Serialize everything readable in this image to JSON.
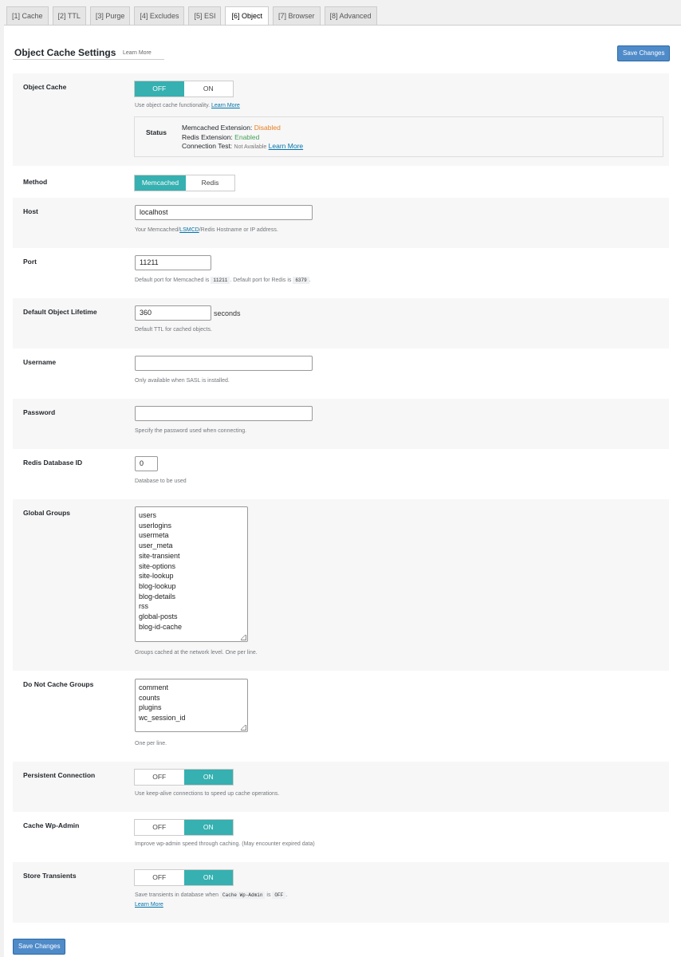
{
  "tabs": [
    "[1] Cache",
    "[2] TTL",
    "[3] Purge",
    "[4] Excludes",
    "[5] ESI",
    "[6] Object",
    "[7] Browser",
    "[8] Advanced"
  ],
  "active_tab": "[6] Object",
  "header": {
    "title": "Object Cache Settings",
    "learn_more": "Learn More",
    "save_label": "Save Changes"
  },
  "toggle_labels": {
    "off": "OFF",
    "on": "ON"
  },
  "object_cache": {
    "label": "Object Cache",
    "value": "OFF",
    "desc": "Use object cache functionality.",
    "desc_link": "Learn More",
    "status": {
      "label": "Status",
      "memcached_label": "Memcached Extension:",
      "memcached_value": "Disabled",
      "redis_label": "Redis Extension:",
      "redis_value": "Enabled",
      "conn_label": "Connection Test:",
      "conn_value": "Not Available",
      "conn_link": "Learn More"
    }
  },
  "method": {
    "label": "Method",
    "options": [
      "Memcached",
      "Redis"
    ],
    "selected": "Memcached"
  },
  "host": {
    "label": "Host",
    "value": "localhost",
    "desc_pre": "Your Memcached/",
    "desc_link": "LSMCD",
    "desc_post": "/Redis Hostname or IP address."
  },
  "port": {
    "label": "Port",
    "value": "11211",
    "desc_a": "Default port for Memcached is",
    "code_a": "11211",
    "desc_b": ". Default port for Redis is",
    "code_b": "6379",
    "desc_c": "."
  },
  "lifetime": {
    "label": "Default Object Lifetime",
    "value": "360",
    "suffix": "seconds",
    "desc": "Default TTL for cached objects."
  },
  "username": {
    "label": "Username",
    "value": "",
    "desc": "Only available when SASL is installed."
  },
  "password": {
    "label": "Password",
    "value": "",
    "desc": "Specify the password used when connecting."
  },
  "redis_db": {
    "label": "Redis Database ID",
    "value": "0",
    "desc": "Database to be used"
  },
  "global_groups": {
    "label": "Global Groups",
    "lines": [
      "users",
      "userlogins",
      "usermeta",
      "user_meta",
      "site-transient",
      "site-options",
      "site-lookup",
      "blog-lookup",
      "blog-details",
      "rss",
      "global-posts",
      "blog-id-cache"
    ],
    "desc": "Groups cached at the network level. One per line."
  },
  "no_cache_groups": {
    "label": "Do Not Cache Groups",
    "lines": [
      "comment",
      "counts",
      "plugins",
      "wc_session_id"
    ],
    "desc": "One per line."
  },
  "persistent": {
    "label": "Persistent Connection",
    "value": "ON",
    "desc": "Use keep-alive connections to speed up cache operations."
  },
  "cache_admin": {
    "label": "Cache Wp-Admin",
    "value": "ON",
    "desc": "Improve wp-admin speed through caching. (May encounter expired data)"
  },
  "transients": {
    "label": "Store Transients",
    "value": "ON",
    "desc_a": "Save transients in database when",
    "code_a": "Cache Wp-Admin",
    "desc_b": "is",
    "code_b": "OFF",
    "desc_c": ".",
    "desc_link": "Learn More"
  },
  "footer": {
    "save_label": "Save Changes"
  }
}
